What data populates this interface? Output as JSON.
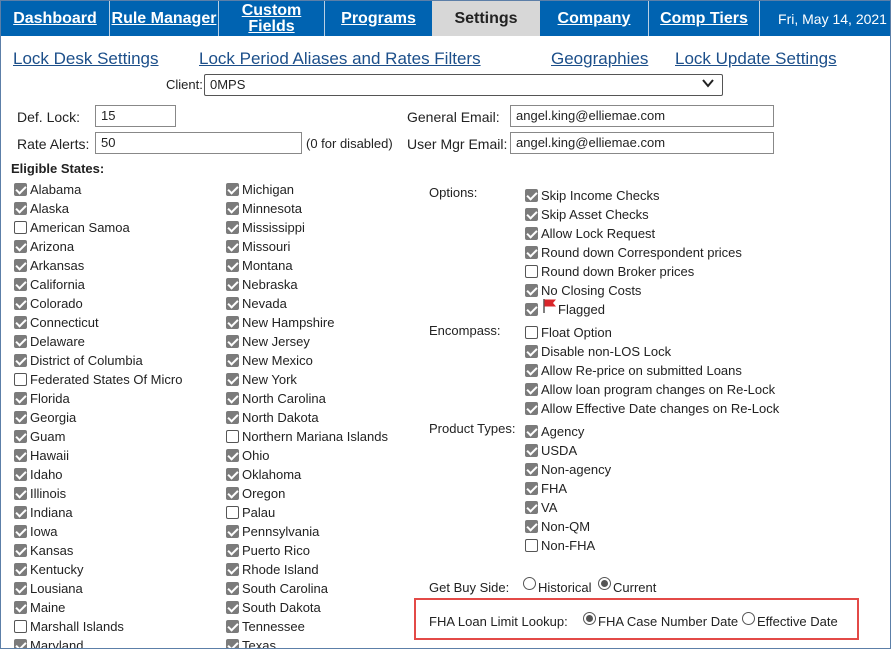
{
  "nav": {
    "tabs": [
      "Dashboard",
      "Rule Manager",
      "Custom Fields",
      "Programs",
      "Settings",
      "Company",
      "Comp Tiers"
    ],
    "active": "Settings",
    "date": "Fri, May 14, 2021"
  },
  "subnav": [
    "Lock Desk Settings",
    "Lock Period Aliases and Rates Filters",
    "Geographies",
    "Lock Update Settings"
  ],
  "client": {
    "label": "Client:",
    "value": "0MPS"
  },
  "fields": {
    "def_lock_label": "Def. Lock:",
    "def_lock": "15",
    "rate_alerts_label": "Rate Alerts:",
    "rate_alerts": "50",
    "rate_alerts_hint": "(0 for disabled)",
    "general_email_label": "General Email:",
    "general_email": "angel.king@elliemae.com",
    "user_mgr_email_label": "User Mgr Email:",
    "user_mgr_email": "angel.king@elliemae.com"
  },
  "eligible_states": {
    "label": "Eligible States:",
    "col1": [
      {
        "name": "Alabama",
        "checked": true
      },
      {
        "name": "Alaska",
        "checked": true
      },
      {
        "name": "American Samoa",
        "checked": false
      },
      {
        "name": "Arizona",
        "checked": true
      },
      {
        "name": "Arkansas",
        "checked": true
      },
      {
        "name": "California",
        "checked": true
      },
      {
        "name": "Colorado",
        "checked": true
      },
      {
        "name": "Connecticut",
        "checked": true
      },
      {
        "name": "Delaware",
        "checked": true
      },
      {
        "name": "District of Columbia",
        "checked": true
      },
      {
        "name": "Federated States Of Micro",
        "checked": false
      },
      {
        "name": "Florida",
        "checked": true
      },
      {
        "name": "Georgia",
        "checked": true
      },
      {
        "name": "Guam",
        "checked": true
      },
      {
        "name": "Hawaii",
        "checked": true
      },
      {
        "name": "Idaho",
        "checked": true
      },
      {
        "name": "Illinois",
        "checked": true
      },
      {
        "name": "Indiana",
        "checked": true
      },
      {
        "name": "Iowa",
        "checked": true
      },
      {
        "name": "Kansas",
        "checked": true
      },
      {
        "name": "Kentucky",
        "checked": true
      },
      {
        "name": "Lousiana",
        "checked": true
      },
      {
        "name": "Maine",
        "checked": true
      },
      {
        "name": "Marshall Islands",
        "checked": false
      },
      {
        "name": "Maryland",
        "checked": true
      }
    ],
    "col2": [
      {
        "name": "Michigan",
        "checked": true
      },
      {
        "name": "Minnesota",
        "checked": true
      },
      {
        "name": "Mississippi",
        "checked": true
      },
      {
        "name": "Missouri",
        "checked": true
      },
      {
        "name": "Montana",
        "checked": true
      },
      {
        "name": "Nebraska",
        "checked": true
      },
      {
        "name": "Nevada",
        "checked": true
      },
      {
        "name": "New Hampshire",
        "checked": true
      },
      {
        "name": "New Jersey",
        "checked": true
      },
      {
        "name": "New Mexico",
        "checked": true
      },
      {
        "name": "New York",
        "checked": true
      },
      {
        "name": "North Carolina",
        "checked": true
      },
      {
        "name": "North Dakota",
        "checked": true
      },
      {
        "name": "Northern Mariana Islands",
        "checked": false
      },
      {
        "name": "Ohio",
        "checked": true
      },
      {
        "name": "Oklahoma",
        "checked": true
      },
      {
        "name": "Oregon",
        "checked": true
      },
      {
        "name": "Palau",
        "checked": false
      },
      {
        "name": "Pennsylvania",
        "checked": true
      },
      {
        "name": "Puerto Rico",
        "checked": true
      },
      {
        "name": "Rhode Island",
        "checked": true
      },
      {
        "name": "South Carolina",
        "checked": true
      },
      {
        "name": "South Dakota",
        "checked": true
      },
      {
        "name": "Tennessee",
        "checked": true
      },
      {
        "name": "Texas",
        "checked": true
      }
    ]
  },
  "options": {
    "label": "Options:",
    "items": [
      {
        "name": "Skip Income Checks",
        "checked": true
      },
      {
        "name": "Skip Asset Checks",
        "checked": true
      },
      {
        "name": "Allow Lock Request",
        "checked": true
      },
      {
        "name": "Round down Correspondent prices",
        "checked": true
      },
      {
        "name": "Round down Broker prices",
        "checked": false
      },
      {
        "name": "No Closing Costs",
        "checked": true
      },
      {
        "name": "Flagged",
        "checked": true,
        "flag": true
      }
    ]
  },
  "encompass": {
    "label": "Encompass:",
    "items": [
      {
        "name": "Float Option",
        "checked": false
      },
      {
        "name": "Disable non-LOS Lock",
        "checked": true
      },
      {
        "name": "Allow Re-price on submitted Loans",
        "checked": true
      },
      {
        "name": "Allow loan program changes on Re-Lock",
        "checked": true
      },
      {
        "name": "Allow Effective Date changes on Re-Lock",
        "checked": true
      }
    ]
  },
  "product_types": {
    "label": "Product Types:",
    "items": [
      {
        "name": "Agency",
        "checked": true
      },
      {
        "name": "USDA",
        "checked": true
      },
      {
        "name": "Non-agency",
        "checked": true
      },
      {
        "name": "FHA",
        "checked": true
      },
      {
        "name": "VA",
        "checked": true
      },
      {
        "name": "Non-QM",
        "checked": true
      },
      {
        "name": "Non-FHA",
        "checked": false
      }
    ]
  },
  "buy_side": {
    "label": "Get Buy Side:",
    "opt1": "Historical",
    "opt2": "Current",
    "selected": "Current"
  },
  "fha_lookup": {
    "label": "FHA Loan Limit Lookup:",
    "opt1": "FHA Case Number Date",
    "opt2": "Effective Date",
    "selected": "FHA Case Number Date"
  },
  "colors": {
    "nav": "#0063b1",
    "active_tab": "#d7d7d7",
    "link": "#1c4f8a",
    "highlight": "#e34a47",
    "flag": "#d9262b"
  }
}
